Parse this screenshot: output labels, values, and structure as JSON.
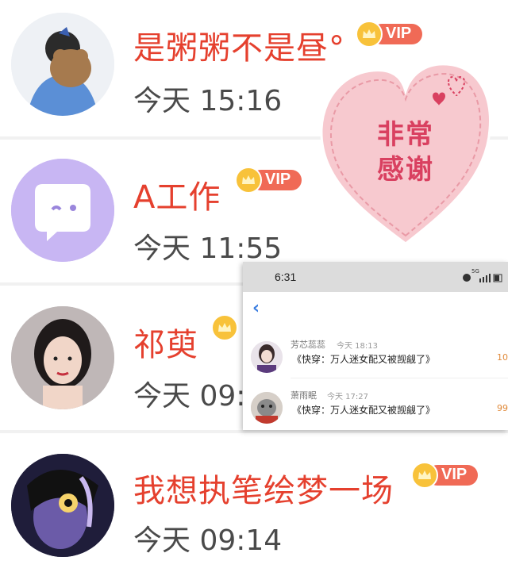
{
  "rows": [
    {
      "name": "是粥粥不是昼°",
      "time": "今天 15:16",
      "vip": "VIP"
    },
    {
      "name": "A工作",
      "time": "今天 11:55",
      "vip": "VIP"
    },
    {
      "name": "祁萸",
      "time": "今天 09:3",
      "vip": ""
    },
    {
      "name": "我想执笔绘梦一场",
      "time": "今天 09:14",
      "vip": "VIP"
    }
  ],
  "heart": {
    "line1": "非常",
    "line2": "感谢"
  },
  "inset": {
    "status_time": "6:31",
    "network": "5G",
    "items": [
      {
        "name": "芳芯蕊蕊",
        "time": "今天 18:13",
        "book": "《快穿：万人迷女配又被觊觎了》",
        "amount": "10"
      },
      {
        "name": "萧雨眠",
        "time": "今天 17:27",
        "book": "《快穿：万人迷女配又被觊觎了》",
        "amount": "99"
      }
    ]
  },
  "colors": {
    "accent": "#e5402e",
    "vip_badge": "#f06a56",
    "crown": "#f8c23a",
    "heart": "#f7c9cf"
  }
}
